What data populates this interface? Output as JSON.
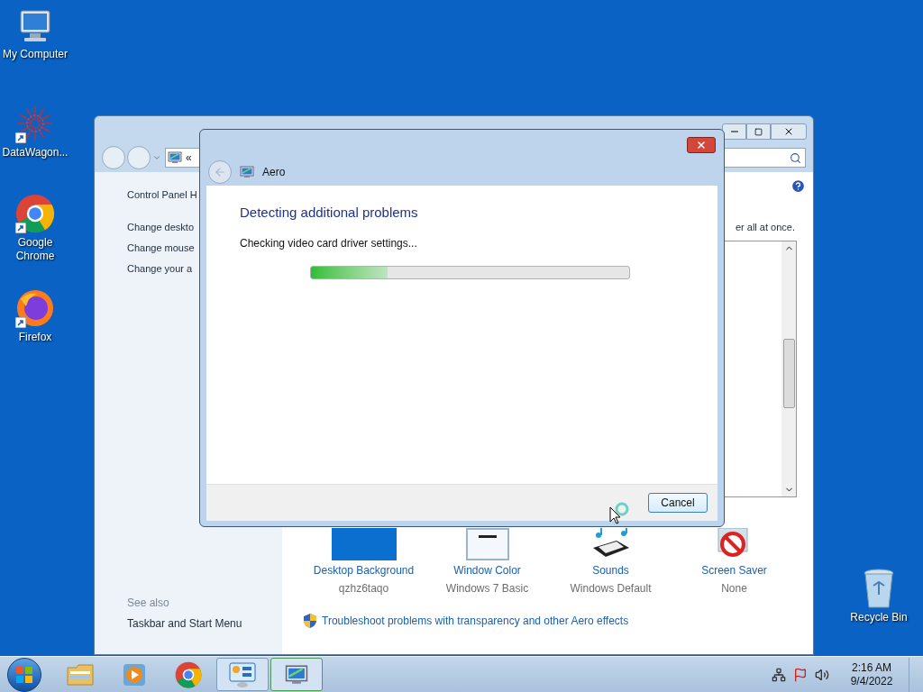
{
  "desktop_icons": [
    {
      "label": "My Computer",
      "kind": "computer",
      "shortcut": false
    },
    {
      "label": "DataWagon...",
      "kind": "app",
      "shortcut": true
    },
    {
      "label": "Google Chrome",
      "kind": "chrome",
      "shortcut": true
    },
    {
      "label": "Firefox",
      "kind": "firefox",
      "shortcut": true
    }
  ],
  "recycle_bin": {
    "label": "Recycle Bin"
  },
  "control_panel": {
    "address": "«",
    "sidebar_links": [
      "Control Panel H",
      "Change deskto",
      "Change mouse",
      "Change your a"
    ],
    "see_also": {
      "heading": "See also",
      "links": [
        "Taskbar and Start Menu"
      ]
    },
    "intro_fragment": "er all at once.",
    "theme_items": [
      {
        "label": "Desktop Background",
        "value": "qzhz6taqo",
        "kind": "background"
      },
      {
        "label": "Window Color",
        "value": "Windows 7 Basic",
        "kind": "color"
      },
      {
        "label": "Sounds",
        "value": "Windows Default",
        "kind": "sounds"
      },
      {
        "label": "Screen Saver",
        "value": "None",
        "kind": "screensaver"
      }
    ],
    "troubleshoot_link": "Troubleshoot problems with transparency and other Aero effects"
  },
  "dialog": {
    "title": "Aero",
    "heading": "Detecting additional problems",
    "status": "Checking video card driver settings...",
    "progress": {
      "level": 0.24
    },
    "buttons": [
      "Cancel"
    ]
  },
  "taskbar": {
    "items": [
      {
        "kind": "explorer",
        "running": false,
        "selected": false
      },
      {
        "kind": "media",
        "running": false,
        "selected": false
      },
      {
        "kind": "chrome",
        "running": false,
        "selected": false
      },
      {
        "kind": "control_panel",
        "running": true,
        "selected": false
      },
      {
        "kind": "troubleshooter",
        "running": true,
        "selected": true
      }
    ],
    "clock": {
      "time": "2:16 AM",
      "date": "9/4/2022"
    }
  }
}
